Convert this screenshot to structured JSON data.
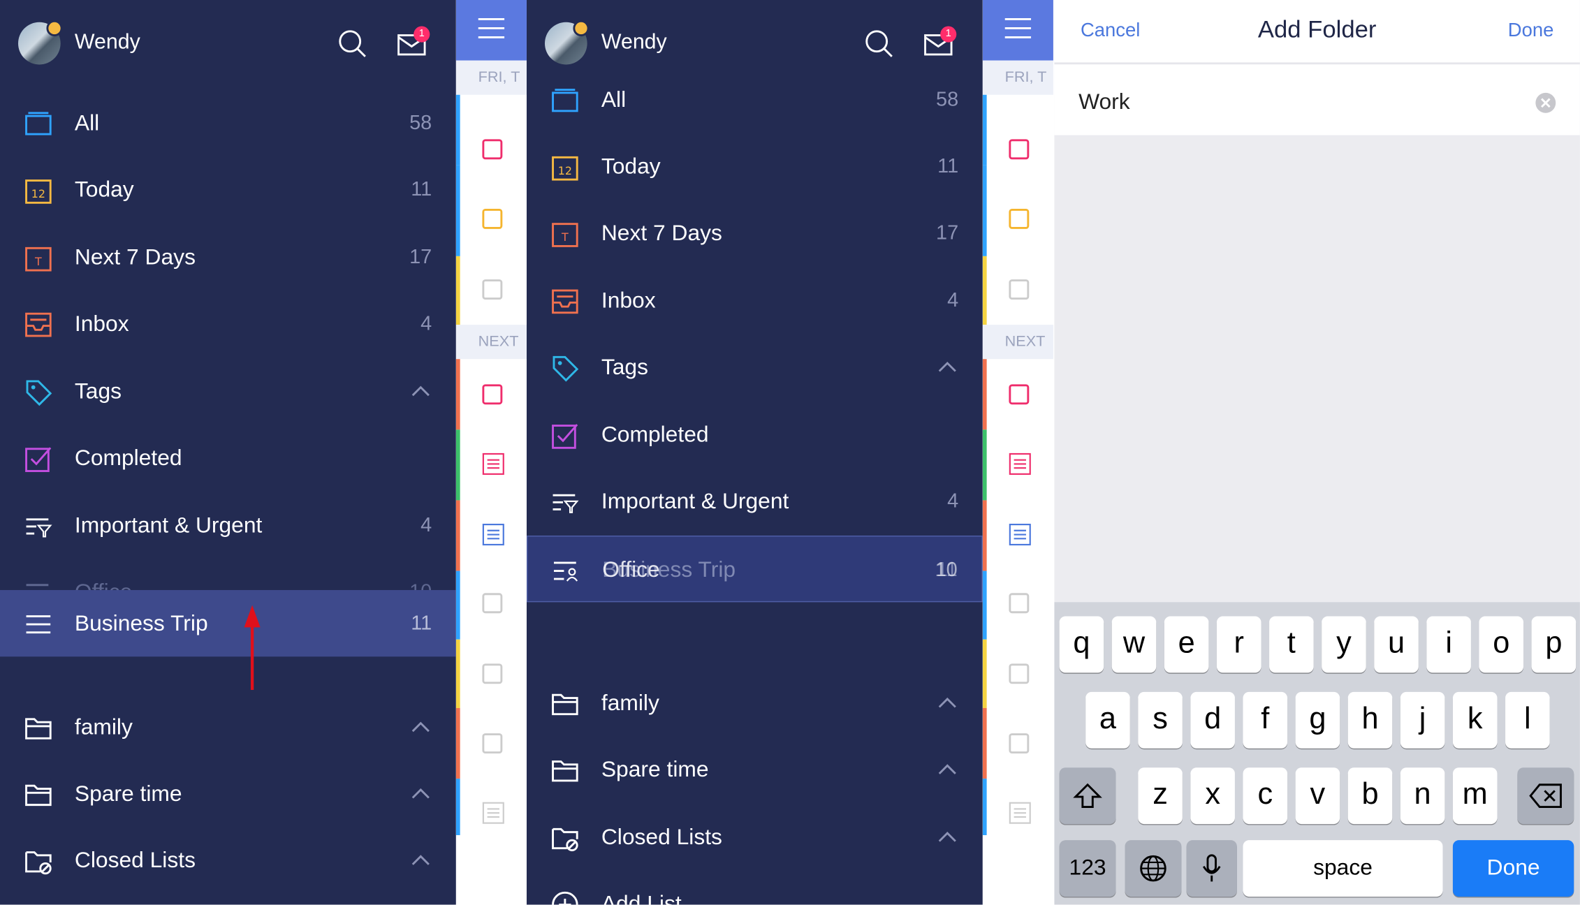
{
  "user": {
    "name": "Wendy",
    "mail_badge": "1"
  },
  "colors": {
    "sidebar_bg": "#232b52",
    "accent": "#5b79e0",
    "link": "#4b78dd",
    "kb_done": "#1a7cf7"
  },
  "panel1": {
    "items": [
      {
        "label": "All",
        "count": "58",
        "icon": "all-icon"
      },
      {
        "label": "Today",
        "count": "11",
        "icon": "calendar-12-icon"
      },
      {
        "label": "Next 7 Days",
        "count": "17",
        "icon": "calendar-t-icon"
      },
      {
        "label": "Inbox",
        "count": "4",
        "icon": "inbox-icon"
      },
      {
        "label": "Tags",
        "icon": "tag-icon"
      },
      {
        "label": "Completed",
        "icon": "check-square-icon"
      },
      {
        "label": "Important & Urgent",
        "count": "4",
        "icon": "filter-list-icon"
      }
    ],
    "ghost": {
      "label": "Office",
      "count": "10"
    },
    "dragging": {
      "label": "Business Trip",
      "count": "11"
    },
    "folders": [
      {
        "label": "family"
      },
      {
        "label": "Spare time"
      },
      {
        "label": "Closed Lists"
      }
    ]
  },
  "panel2": {
    "items": [
      {
        "label": "All",
        "count": "58"
      },
      {
        "label": "Today",
        "count": "11"
      },
      {
        "label": "Next 7 Days",
        "count": "17"
      },
      {
        "label": "Inbox",
        "count": "4"
      },
      {
        "label": "Tags"
      },
      {
        "label": "Completed"
      },
      {
        "label": "Important & Urgent",
        "count": "4"
      }
    ],
    "overlap": {
      "label_a": "Office",
      "label_b": "Business Trip",
      "count_a": "10",
      "count_b": "11"
    },
    "folders": [
      {
        "label": "family"
      },
      {
        "label": "Spare time"
      },
      {
        "label": "Closed Lists"
      }
    ],
    "add_list": "Add List"
  },
  "strip": {
    "date_label": "FRI, T",
    "next_label": "NEXT"
  },
  "add_folder": {
    "cancel": "Cancel",
    "title": "Add Folder",
    "done": "Done",
    "value": "Work"
  },
  "keyboard": {
    "row1": [
      "q",
      "w",
      "e",
      "r",
      "t",
      "y",
      "u",
      "i",
      "o",
      "p"
    ],
    "row2": [
      "a",
      "s",
      "d",
      "f",
      "g",
      "h",
      "j",
      "k",
      "l"
    ],
    "row3": [
      "z",
      "x",
      "c",
      "v",
      "b",
      "n",
      "m"
    ],
    "numbers": "123",
    "space": "space",
    "done": "Done"
  }
}
